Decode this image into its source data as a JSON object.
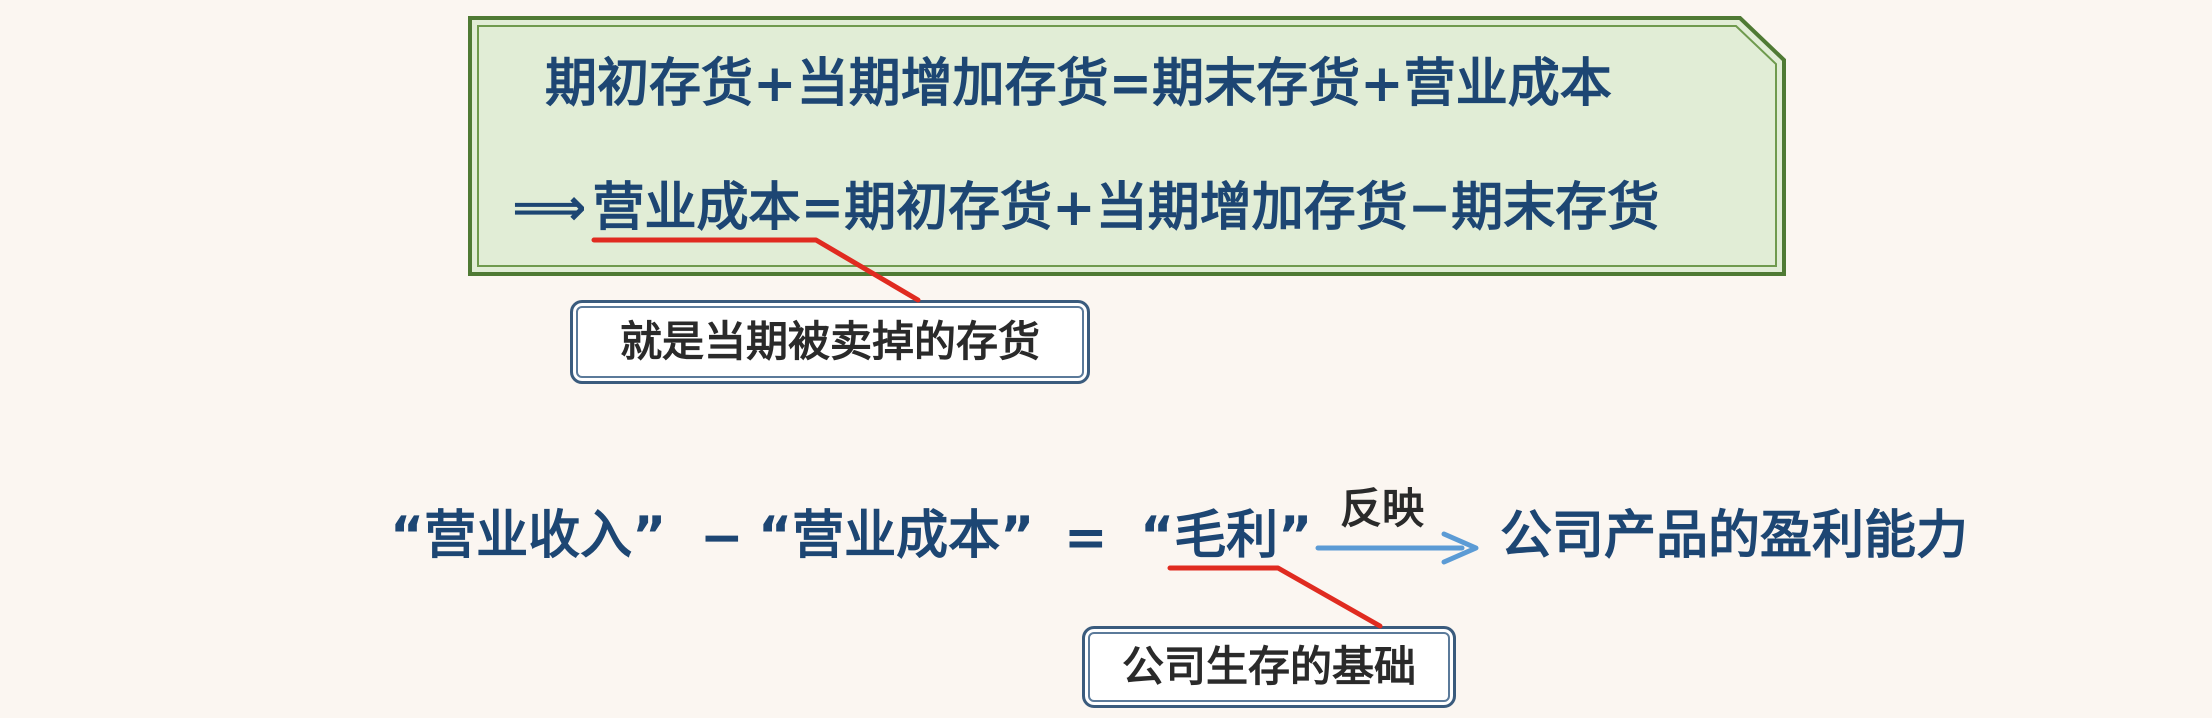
{
  "formula_box": {
    "line1": "期初存货+当期增加存货=期末存货+营业成本",
    "line2_arrow": "⟹",
    "line2_highlight": "营业成本",
    "line2_rest": "=期初存货+当期增加存货−期末存货",
    "fill_color": "#e1edd6",
    "border_color": "#4f7a34"
  },
  "callout_top": "就是当期被卖掉的存货",
  "equation": {
    "term1": "“营业收入”",
    "minus": "−",
    "term2": "“营业成本”",
    "equals": "=",
    "term3": "“毛利”",
    "arrow_label": "反映",
    "result": "公司产品的盈利能力"
  },
  "callout_bottom": "公司生存的基础",
  "colors": {
    "text_primary": "#1d4673",
    "underline_red": "#e02b20",
    "arrow_blue": "#5b9bd5"
  }
}
